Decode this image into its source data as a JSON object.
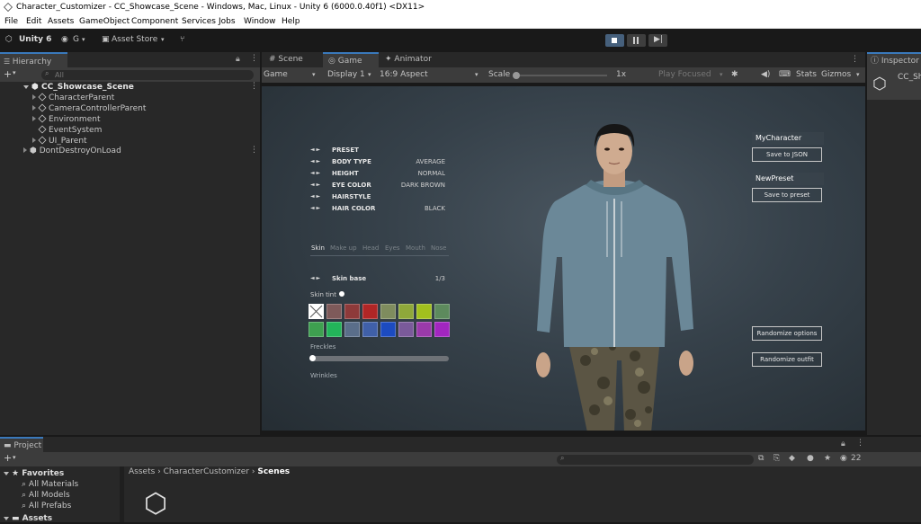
{
  "window_title": "Character_Customizer - CC_Showcase_Scene - Windows, Mac, Linux - Unity 6 (6000.0.40f1) <DX11>",
  "menu": [
    "File",
    "Edit",
    "Assets",
    "GameObject",
    "Component",
    "Services",
    "Jobs",
    "Window",
    "Help"
  ],
  "toolbar": {
    "unity_label": "Unity 6",
    "account_label": "G",
    "asset_store_label": "Asset Store"
  },
  "hierarchy": {
    "tab_label": "Hierarchy",
    "search_placeholder": "All",
    "items": [
      "CC_Showcase_Scene",
      "CharacterParent",
      "CameraControllerParent",
      "Environment",
      "EventSystem",
      "UI_Parent",
      "DontDestroyOnLoad"
    ]
  },
  "view_tabs": {
    "scene": "Scene",
    "game": "Game",
    "animator": "Animator"
  },
  "game_toolbar": {
    "mode": "Game",
    "display": "Display 1",
    "aspect": "16:9 Aspect",
    "scale_label": "Scale",
    "scale_value": "1x",
    "play_focused": "Play Focused",
    "stats": "Stats",
    "gizmos": "Gizmos"
  },
  "customizer": {
    "options": [
      {
        "label": "PRESET",
        "value": ""
      },
      {
        "label": "BODY TYPE",
        "value": "AVERAGE"
      },
      {
        "label": "HEIGHT",
        "value": "NORMAL"
      },
      {
        "label": "EYE COLOR",
        "value": "DARK BROWN"
      },
      {
        "label": "HAIRSTYLE",
        "value": ""
      },
      {
        "label": "HAIR COLOR",
        "value": "BLACK"
      }
    ],
    "arrows": "◄ ►",
    "categories": [
      "Skin",
      "Make up",
      "Head",
      "Eyes",
      "Mouth",
      "Nose"
    ],
    "skin_base_label": "Skin base",
    "skin_base_value": "1/3",
    "skin_tint_label": "Skin tint",
    "swatches_row1": [
      "#ffffff",
      "#7e5a5a",
      "#8e3a3a",
      "#b02626",
      "#7f8c5e",
      "#8fa83a",
      "#a2c01e",
      "#5d8a5d"
    ],
    "swatches_row2": [
      "#3ea050",
      "#23b45a",
      "#5a6e8a",
      "#4060a8",
      "#1c4bc0",
      "#7a5a9a",
      "#9a3aaa",
      "#a226c0"
    ],
    "freckles_label": "Freckles",
    "freckles_level": 0,
    "wrinkles_label": "Wrinkles",
    "character_name": "MyCharacter",
    "save_json": "Save to JSON",
    "preset_name": "NewPreset",
    "save_preset": "Save to preset",
    "randomize_options": "Randomize options",
    "randomize_outfit": "Randomize outfit"
  },
  "inspector": {
    "tab_label": "Inspector",
    "object_name": "CC_Sh"
  },
  "project": {
    "tab_label": "Project",
    "favorites_label": "Favorites",
    "favorites": [
      "All Materials",
      "All Models",
      "All Prefabs"
    ],
    "assets_root": "Assets",
    "breadcrumb": [
      "Assets",
      "CharacterCustomizer",
      "Scenes"
    ],
    "hidden_count": "22"
  }
}
